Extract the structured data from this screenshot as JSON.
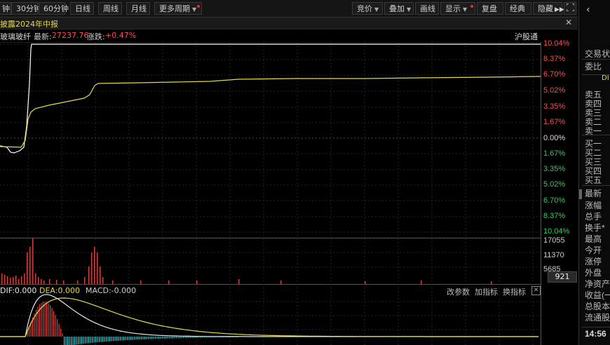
{
  "toolbar": {
    "left_buttons": [
      "钟",
      "30分钟",
      "60分钟",
      "日线",
      "周线",
      "月线",
      "更多周期"
    ],
    "right_buttons": [
      "竞价",
      "叠加",
      "画线",
      "显示",
      "复盘",
      "经典",
      "隐藏"
    ]
  },
  "title": "披露2024年中报",
  "close_glyph": "✕",
  "info": {
    "name": "玻璃玻纤",
    "latest_label": "最新:",
    "latest_value": "27237.76",
    "change_label": "涨跌:",
    "change_value": "+0.47%",
    "market": "沪股通"
  },
  "price_axis": [
    "10.04%",
    "8.37%",
    "6.70%",
    "5.02%",
    "3.35%",
    "1.67%",
    "0.00%",
    "1.67%",
    "3.35%",
    "5.02%",
    "6.70%",
    "8.37%",
    "10.04%"
  ],
  "volume_axis": [
    "17055",
    "11370",
    "5685"
  ],
  "volume_current": "921",
  "macd": {
    "dif": "DIF:0.000",
    "dea": "DEA:0.000",
    "macd": "MACD:-0.000",
    "buttons": [
      "改参数",
      "加指标",
      "换指标"
    ]
  },
  "right_panel": {
    "labels": [
      "交易状",
      "委比",
      "卖五",
      "卖四",
      "卖三",
      "卖二",
      "卖一",
      "买一",
      "买二",
      "买三",
      "买四",
      "买五",
      "最新",
      "涨幅",
      "总手",
      "换手*",
      "最高",
      "今开",
      "涨停",
      "外盘",
      "净资产",
      "收益(一",
      "总股本",
      "流通股"
    ],
    "time": "14:56",
    "tab_glyph": "DI",
    "back_icon": "‹"
  },
  "colors": {
    "up": "#ff4d4d",
    "down": "#30d060",
    "avg_line": "#e6d84a",
    "price_line": "#ffffff"
  }
}
